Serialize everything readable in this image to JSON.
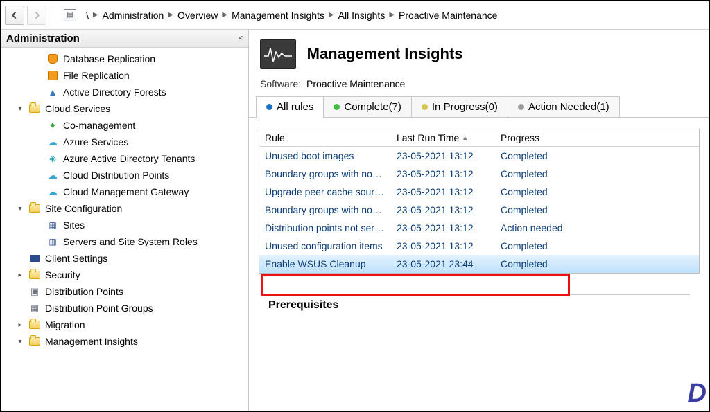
{
  "breadcrumb": [
    "\\",
    "Administration",
    "Overview",
    "Management Insights",
    "All Insights",
    "Proactive Maintenance"
  ],
  "sidebar": {
    "title": "Administration",
    "items": [
      {
        "label": "Database Replication",
        "indent": 2,
        "icon": "db",
        "caret": ""
      },
      {
        "label": "File Replication",
        "indent": 2,
        "icon": "file-orange",
        "caret": ""
      },
      {
        "label": "Active Directory Forests",
        "indent": 2,
        "icon": "tree-blue",
        "caret": ""
      },
      {
        "label": "Cloud Services",
        "indent": 1,
        "icon": "folder",
        "caret": "▾"
      },
      {
        "label": "Co-management",
        "indent": 2,
        "icon": "cog-teal",
        "caret": ""
      },
      {
        "label": "Azure Services",
        "indent": 2,
        "icon": "cloud-cyan",
        "caret": ""
      },
      {
        "label": "Azure Active Directory Tenants",
        "indent": 2,
        "icon": "diamond-teal",
        "caret": ""
      },
      {
        "label": "Cloud Distribution Points",
        "indent": 2,
        "icon": "cloud-cyan",
        "caret": ""
      },
      {
        "label": "Cloud Management Gateway",
        "indent": 2,
        "icon": "cloud-cyan",
        "caret": ""
      },
      {
        "label": "Site Configuration",
        "indent": 1,
        "icon": "folder",
        "caret": "▾"
      },
      {
        "label": "Sites",
        "indent": 2,
        "icon": "site-navy",
        "caret": ""
      },
      {
        "label": "Servers and Site System Roles",
        "indent": 2,
        "icon": "server-navy",
        "caret": ""
      },
      {
        "label": "Client Settings",
        "indent": 1,
        "icon": "client",
        "caret": ""
      },
      {
        "label": "Security",
        "indent": 1,
        "icon": "folder",
        "caret": "▸"
      },
      {
        "label": "Distribution Points",
        "indent": 1,
        "icon": "dp",
        "caret": ""
      },
      {
        "label": "Distribution Point Groups",
        "indent": 1,
        "icon": "dpg",
        "caret": ""
      },
      {
        "label": "Migration",
        "indent": 1,
        "icon": "folder",
        "caret": "▸"
      },
      {
        "label": "Management Insights",
        "indent": 1,
        "icon": "folder",
        "caret": "▾"
      }
    ]
  },
  "header": {
    "title": "Management Insights",
    "software_label": "Software:",
    "software_value": "Proactive Maintenance"
  },
  "tabs": {
    "all": "All rules",
    "complete": "Complete(7)",
    "inprogress": "In Progress(0)",
    "actionneeded": "Action Needed(1)"
  },
  "grid": {
    "columns": {
      "rule": "Rule",
      "time": "Last Run Time",
      "progress": "Progress"
    },
    "rows": [
      {
        "rule": "Unused boot images",
        "time": "23-05-2021 13:12",
        "progress": "Completed"
      },
      {
        "rule": "Boundary groups with no…",
        "time": "23-05-2021 13:12",
        "progress": "Completed"
      },
      {
        "rule": "Upgrade peer cache sourc…",
        "time": "23-05-2021 13:12",
        "progress": "Completed"
      },
      {
        "rule": "Boundary groups with no…",
        "time": "23-05-2021 13:12",
        "progress": "Completed"
      },
      {
        "rule": "Distribution points not ser…",
        "time": "23-05-2021 13:12",
        "progress": "Action needed"
      },
      {
        "rule": "Unused configuration items",
        "time": "23-05-2021 13:12",
        "progress": "Completed"
      },
      {
        "rule": "Enable WSUS Cleanup",
        "time": "23-05-2021 23:44",
        "progress": "Completed"
      }
    ]
  },
  "prereq": {
    "title": "Prerequisites"
  },
  "watermark": "D"
}
